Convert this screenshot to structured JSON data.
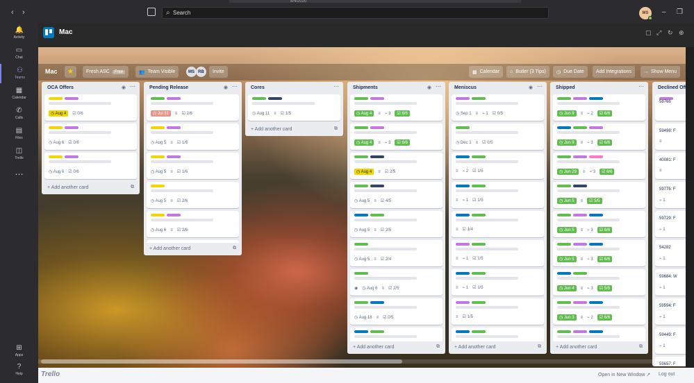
{
  "window": {
    "date": "8/4/2020"
  },
  "topbar": {
    "search_label": "Search",
    "user_initials": "MS"
  },
  "rail": {
    "items": [
      {
        "label": "Activity",
        "icon": "bell-icon"
      },
      {
        "label": "Chat",
        "icon": "chat-icon"
      },
      {
        "label": "Teams",
        "icon": "teams-icon",
        "active": true
      },
      {
        "label": "Calendar",
        "icon": "calendar-icon"
      },
      {
        "label": "Calls",
        "icon": "phone-icon"
      },
      {
        "label": "Files",
        "icon": "file-icon"
      },
      {
        "label": "Trello",
        "icon": "trello-icon"
      }
    ],
    "more": "⋯",
    "bottom": [
      {
        "label": "Apps",
        "icon": "apps-icon"
      },
      {
        "label": "Help",
        "icon": "help-icon"
      }
    ]
  },
  "app": {
    "title": "Mac"
  },
  "board": {
    "title": "Mac",
    "fresh": "Fresh ASC",
    "fresh_tag": "Free",
    "visibility": "Team Visible",
    "members": [
      "MS",
      "RB"
    ],
    "invite": "Invite",
    "calendar": "Calendar",
    "butler": "Butler (3 Tips)",
    "due_date": "Due Date",
    "integrations": "Add Integrations",
    "show_menu": "Show Menu",
    "add_card": "Add another card",
    "lists": [
      {
        "name": "OCA Offers",
        "eye": true,
        "cards": [
          {
            "labels": [
              "#f2d600",
              "#c377e0"
            ],
            "due": "Aug 4",
            "due_style": "yellow",
            "check": "0/6"
          },
          {
            "labels": [
              "#f2d600",
              "#c377e0"
            ],
            "due": "Aug 6",
            "due_style": "plain",
            "check": "0/6"
          },
          {
            "labels": [
              "#f2d600",
              "#c377e0"
            ],
            "due": "Aug 6",
            "due_style": "plain",
            "check": "0/6"
          }
        ]
      },
      {
        "name": "Pending Release",
        "eye": true,
        "cards": [
          {
            "labels": [
              "#61bd4f",
              "#c377e0"
            ],
            "due": "Jul 31",
            "due_style": "red",
            "desc": true,
            "check": "2/6"
          },
          {
            "labels": [
              "#f2d600",
              "#c377e0"
            ],
            "due": "Aug 5",
            "due_style": "plain",
            "desc": true,
            "check": "1/6"
          },
          {
            "labels": [
              "#f2d600",
              "#c377e0"
            ],
            "due": "Aug 5",
            "due_style": "plain",
            "desc": true,
            "check": "1/6"
          },
          {
            "labels": [
              "#f2d600"
            ],
            "due": "Aug 5",
            "due_style": "plain",
            "desc": true,
            "check": "2/6"
          },
          {
            "labels": [
              "#f2d600",
              "#c377e0"
            ],
            "due": "Aug 6",
            "due_style": "plain",
            "desc": true,
            "check": "2/6"
          },
          {
            "labels": [
              "#f2d600",
              "#c377e0"
            ],
            "due": "Aug 11",
            "due_style": "plain",
            "desc": true,
            "check": "2/6"
          }
        ]
      },
      {
        "name": "Cores",
        "eye": false,
        "cards": [
          {
            "labels": [
              "#61bd4f",
              "#344563"
            ],
            "due": "Aug 11",
            "due_style": "plain",
            "desc": true,
            "check": "1/5"
          }
        ]
      },
      {
        "name": "Shipments",
        "eye": true,
        "cards": [
          {
            "labels": [
              "#61bd4f",
              "#c377e0"
            ],
            "due": "Aug 4",
            "due_style": "green",
            "desc": true,
            "attach": "3",
            "check": "6/6",
            "check_green": true
          },
          {
            "labels": [
              "#61bd4f",
              "#c377e0"
            ],
            "due": "Aug 4",
            "due_style": "green",
            "desc": true,
            "attach": "3",
            "check": "6/6",
            "check_green": true
          },
          {
            "labels": [
              "#61bd4f",
              "#344563"
            ],
            "due": "Aug 4",
            "due_style": "yellow",
            "desc": true,
            "check": "2/5"
          },
          {
            "labels": [
              "#61bd4f",
              "#344563"
            ],
            "due": "Aug 5",
            "due_style": "plain",
            "desc": true,
            "check": "4/5"
          },
          {
            "labels": [
              "#0079bf",
              "#61bd4f"
            ],
            "due": "Aug 5",
            "due_style": "plain",
            "desc": true,
            "check": "2/5"
          },
          {
            "labels": [
              "#61bd4f"
            ],
            "due": "Aug 5",
            "due_style": "plain",
            "desc": true,
            "check": "2/4"
          },
          {
            "labels": [
              "#61bd4f"
            ],
            "due": "Aug 6",
            "due_style": "plain",
            "watch": true,
            "desc": true,
            "check": "2/5"
          },
          {
            "labels": [
              "#61bd4f",
              "#0079bf"
            ],
            "due": "Aug 18",
            "due_style": "plain",
            "desc": true,
            "check": "0/5"
          },
          {
            "labels": [
              "#0079bf",
              "#61bd4f"
            ],
            "due": "",
            "due_style": "plain",
            "check": ""
          }
        ]
      },
      {
        "name": "Meniscus",
        "eye": true,
        "cards": [
          {
            "labels": [
              "#c377e0",
              "#61bd4f"
            ],
            "due": "Sep 1",
            "due_style": "plain",
            "desc": true,
            "attach": "1",
            "check": "0/5"
          },
          {
            "labels": [
              "#61bd4f"
            ],
            "due": "Dec 1",
            "due_style": "plain",
            "desc": true,
            "check": "0/5"
          },
          {
            "labels": [
              "#0079bf",
              "#61bd4f"
            ],
            "due": "",
            "due_style": "plain",
            "desc": true,
            "attach": "2",
            "check": "1/5"
          },
          {
            "labels": [
              "#0079bf",
              "#61bd4f"
            ],
            "due": "",
            "due_style": "plain",
            "desc": true,
            "attach": "1",
            "check": "1/5"
          },
          {
            "labels": [
              "#0079bf",
              "#61bd4f"
            ],
            "due": "",
            "due_style": "plain",
            "desc": true,
            "check": "1/4"
          },
          {
            "labels": [
              "#c377e0",
              "#61bd4f"
            ],
            "due": "",
            "due_style": "plain",
            "desc": true,
            "attach": "1",
            "check": "1/5"
          },
          {
            "labels": [
              "#0079bf",
              "#61bd4f"
            ],
            "due": "",
            "due_style": "plain",
            "desc": true,
            "attach": "1",
            "check": "1/5"
          },
          {
            "labels": [
              "#c377e0",
              "#61bd4f"
            ],
            "due": "",
            "due_style": "plain",
            "desc": true,
            "check": "1/5"
          },
          {
            "labels": [
              "#0079bf",
              "#61bd4f"
            ],
            "due": "",
            "due_style": "plain",
            "check": ""
          }
        ]
      },
      {
        "name": "Shipped",
        "eye": false,
        "cards": [
          {
            "labels": [
              "#61bd4f",
              "#c377e0",
              "#0079bf"
            ],
            "due": "Jun 9",
            "due_style": "green",
            "desc": true,
            "attach": "2",
            "check": "6/6",
            "check_green": true
          },
          {
            "labels": [
              "#0079bf",
              "#61bd4f",
              "#c377e0"
            ],
            "due": "Jun 9",
            "due_style": "green",
            "desc": true,
            "attach": "3",
            "check": "6/6",
            "check_green": true
          },
          {
            "labels": [
              "#61bd4f",
              "#c377e0",
              "#ff78cb"
            ],
            "due": "Jun 29",
            "due_style": "green",
            "desc": true,
            "attach": "3",
            "check": "6/6",
            "check_green": true
          },
          {
            "labels": [
              "#61bd4f",
              "#344563"
            ],
            "due": "Jun 5",
            "due_style": "green",
            "desc": true,
            "check": "5/5",
            "check_green": true
          },
          {
            "labels": [
              "#61bd4f",
              "#c377e0",
              "#0079bf"
            ],
            "due": "Jun 5",
            "due_style": "green",
            "desc": true,
            "attach": "3",
            "check": "6/6",
            "check_green": true
          },
          {
            "labels": [
              "#61bd4f",
              "#c377e0",
              "#0079bf"
            ],
            "due": "Jun 5",
            "due_style": "green",
            "desc": true,
            "attach": "3",
            "check": "6/6",
            "check_green": true
          },
          {
            "labels": [
              "#0079bf",
              "#61bd4f"
            ],
            "due": "Jun 4",
            "due_style": "green",
            "desc": true,
            "attach": "3",
            "check": "5/5",
            "check_green": true
          },
          {
            "labels": [
              "#61bd4f",
              "#c377e0",
              "#0079bf"
            ],
            "due": "Jun 3",
            "due_style": "green",
            "desc": true,
            "attach": "2",
            "check": "6/6",
            "check_green": true
          },
          {
            "labels": [
              "#61bd4f",
              "#c377e0",
              "#0079bf"
            ],
            "due": "",
            "due_style": "plain",
            "check": ""
          }
        ]
      },
      {
        "name": "Declined Offers",
        "eye": false,
        "partial": true,
        "cards": [
          {
            "labels": [
              "#c377e0"
            ],
            "title": "58766",
            "due": "",
            "due_style": "plain",
            "check": ""
          },
          {
            "labels": [],
            "title": "59498: F",
            "due": "",
            "due_style": "plain",
            "desc": true,
            "check": ""
          },
          {
            "labels": [],
            "title": "40081: F",
            "due": "",
            "due_style": "plain",
            "desc": true,
            "check": ""
          },
          {
            "labels": [],
            "title": "59776: F",
            "due": "",
            "due_style": "plain",
            "attach": "1",
            "check": ""
          },
          {
            "labels": [],
            "title": "59729: F",
            "due": "",
            "due_style": "plain",
            "attach": "1",
            "check": ""
          },
          {
            "labels": [],
            "title": "54282",
            "due": "",
            "due_style": "plain",
            "attach": "1",
            "check": ""
          },
          {
            "labels": [],
            "title": "59684: W",
            "due": "",
            "due_style": "plain",
            "attach": "1",
            "check": ""
          },
          {
            "labels": [],
            "title": "59594: F",
            "due": "",
            "due_style": "plain",
            "attach": "1",
            "check": ""
          },
          {
            "labels": [],
            "title": "59449: F",
            "due": "",
            "due_style": "plain",
            "attach": "1",
            "check": ""
          },
          {
            "labels": [],
            "title": "59657: F",
            "due": "",
            "due_style": "plain",
            "attach": "1",
            "check": ""
          }
        ]
      }
    ]
  },
  "footer": {
    "brand": "Trello",
    "open_new": "Open in New Window ↗",
    "log_out": "Log out"
  }
}
